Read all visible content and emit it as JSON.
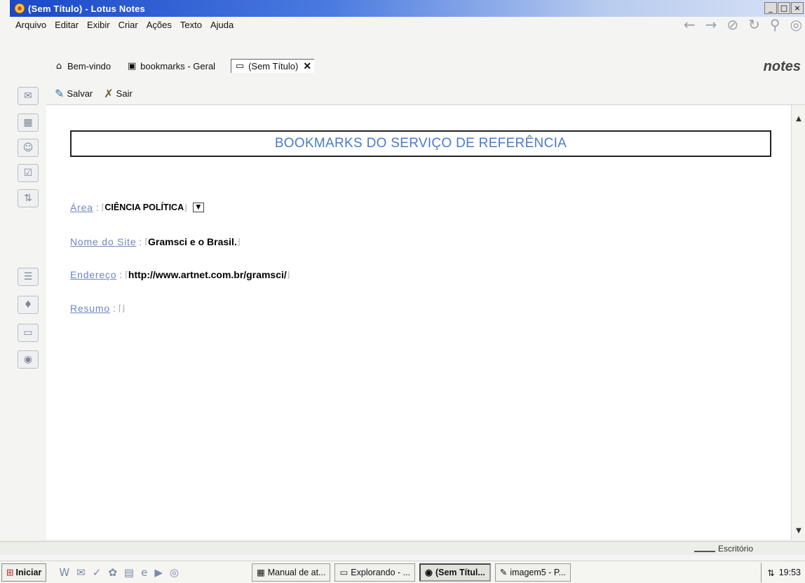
{
  "window": {
    "title": "(Sem Título) - Lotus Notes",
    "controls": {
      "minimize": "_",
      "maximize": "□",
      "close": "×"
    }
  },
  "menu": [
    "Arquivo",
    "Editar",
    "Exibir",
    "Criar",
    "Ações",
    "Texto",
    "Ajuda"
  ],
  "tabs": [
    {
      "label": "Bem-vindo",
      "icon": "home-icon"
    },
    {
      "label": "bookmarks - Geral",
      "icon": "database-icon"
    },
    {
      "label": "(Sem Título)",
      "icon": "document-icon",
      "active": true
    }
  ],
  "brand": "notes",
  "actions": [
    {
      "label": "Salvar",
      "icon": "save-icon"
    },
    {
      "label": "Sair",
      "icon": "exit-icon"
    }
  ],
  "document": {
    "heading": "BOOKMARKS DO SERVIÇO DE REFERÊNCIA",
    "fields": [
      {
        "label": "Área",
        "value": "CIÊNCIA POLÍTICA",
        "has_dropdown": true
      },
      {
        "label": "Nome do Site",
        "value": "Gramsci e o Brasil."
      },
      {
        "label": "Endereço",
        "value": "http://www.artnet.com.br/gramsci/"
      },
      {
        "label": "Resumo",
        "value": ""
      }
    ]
  },
  "status": {
    "location": "Escritório"
  },
  "taskbar": {
    "start": "Iniciar",
    "tasks": [
      {
        "label": "Manual de at..."
      },
      {
        "label": "Explorando - ..."
      },
      {
        "label": "(Sem Títul...",
        "active": true
      },
      {
        "label": "imagem5 - P..."
      }
    ],
    "clock": "19:53"
  },
  "colors": {
    "title_bar": "#1a48c8",
    "heading_text": "#4b7ac6",
    "field_label": "#6d86c0"
  }
}
